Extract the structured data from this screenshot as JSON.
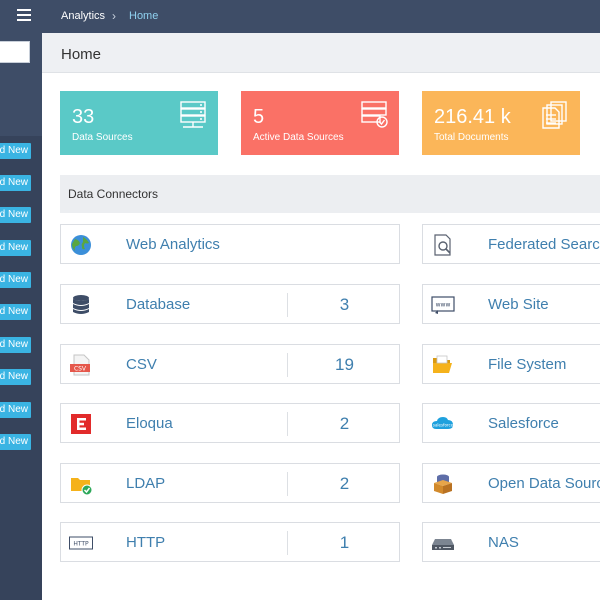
{
  "breadcrumb": {
    "app": "Analytics",
    "separator": "›",
    "current": "Home"
  },
  "page": {
    "title": "Home"
  },
  "sidebar": {
    "add_new_label": "Add New",
    "add_new_count": 10
  },
  "stats": [
    {
      "value": "33",
      "label": "Data Sources",
      "color": "#5ac9c7",
      "icon": "server-network-icon"
    },
    {
      "value": "5",
      "label": "Active Data Sources",
      "color": "#fa7166",
      "icon": "server-check-icon"
    },
    {
      "value": "216.41 k",
      "label": "Total Documents",
      "color": "#fbb659",
      "icon": "documents-icon"
    }
  ],
  "section": {
    "title": "Data Connectors"
  },
  "connectors_left": [
    {
      "name": "Web Analytics",
      "count": "",
      "icon": "globe-icon"
    },
    {
      "name": "Database",
      "count": "3",
      "icon": "database-icon"
    },
    {
      "name": "CSV",
      "count": "19",
      "icon": "csv-file-icon"
    },
    {
      "name": "Eloqua",
      "count": "2",
      "icon": "eloqua-icon"
    },
    {
      "name": "LDAP",
      "count": "2",
      "icon": "folder-check-icon"
    },
    {
      "name": "HTTP",
      "count": "1",
      "icon": "http-icon"
    }
  ],
  "connectors_right": [
    {
      "name": "Federated Search",
      "icon": "document-search-icon"
    },
    {
      "name": "Web Site",
      "icon": "www-icon"
    },
    {
      "name": "File System",
      "icon": "folder-open-icon"
    },
    {
      "name": "Salesforce",
      "icon": "salesforce-cloud-icon"
    },
    {
      "name": "Open Data Source",
      "icon": "open-box-icon"
    },
    {
      "name": "NAS",
      "icon": "nas-drive-icon"
    }
  ],
  "colors": {
    "sidebar": "#3e4d67",
    "accent": "#3ab4e3",
    "link": "#3f7fae"
  }
}
